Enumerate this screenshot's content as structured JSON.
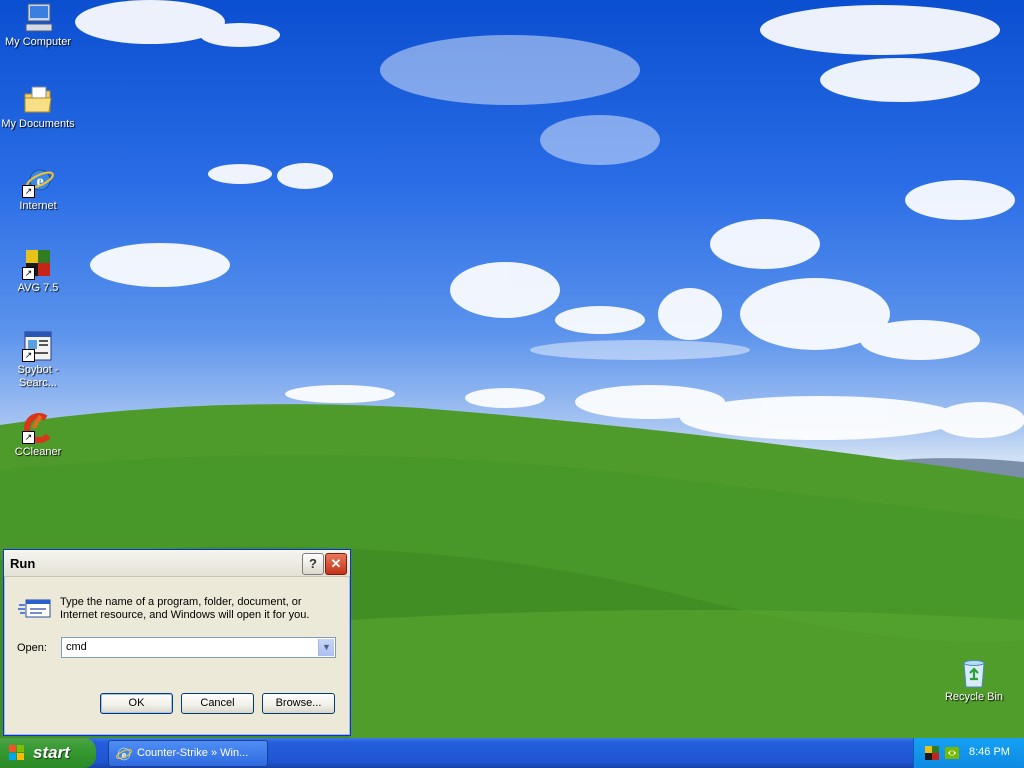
{
  "desktop": {
    "icons": [
      {
        "label": "My Computer",
        "icon": "my-computer-icon"
      },
      {
        "label": "My Documents",
        "icon": "my-documents-icon"
      },
      {
        "label": "Internet",
        "icon": "internet-explorer-icon"
      },
      {
        "label": "AVG 7.5",
        "icon": "avg-icon"
      },
      {
        "label_line1": "Spybot -",
        "label_line2": "Searc...",
        "icon": "spybot-icon"
      },
      {
        "label": "CCleaner",
        "icon": "ccleaner-icon"
      }
    ],
    "recycle_bin": {
      "label": "Recycle Bin",
      "icon": "recycle-bin-icon"
    }
  },
  "run_dialog": {
    "title": "Run",
    "help_glyph": "?",
    "close_glyph": "✕",
    "description": "Type the name of a program, folder, document, or Internet resource, and Windows will open it for you.",
    "open_label": "Open:",
    "open_value": "cmd",
    "ok_label": "OK",
    "cancel_label": "Cancel",
    "browse_label": "Browse..."
  },
  "taskbar": {
    "start_label": "start",
    "task_item_label": "Counter-Strike » Win...",
    "clock": "8:46 PM"
  },
  "colors": {
    "taskbar_blue": "#245edb",
    "start_green": "#379a32",
    "tray_blue": "#0f8ae3",
    "dialog_face": "#ece9d8"
  }
}
